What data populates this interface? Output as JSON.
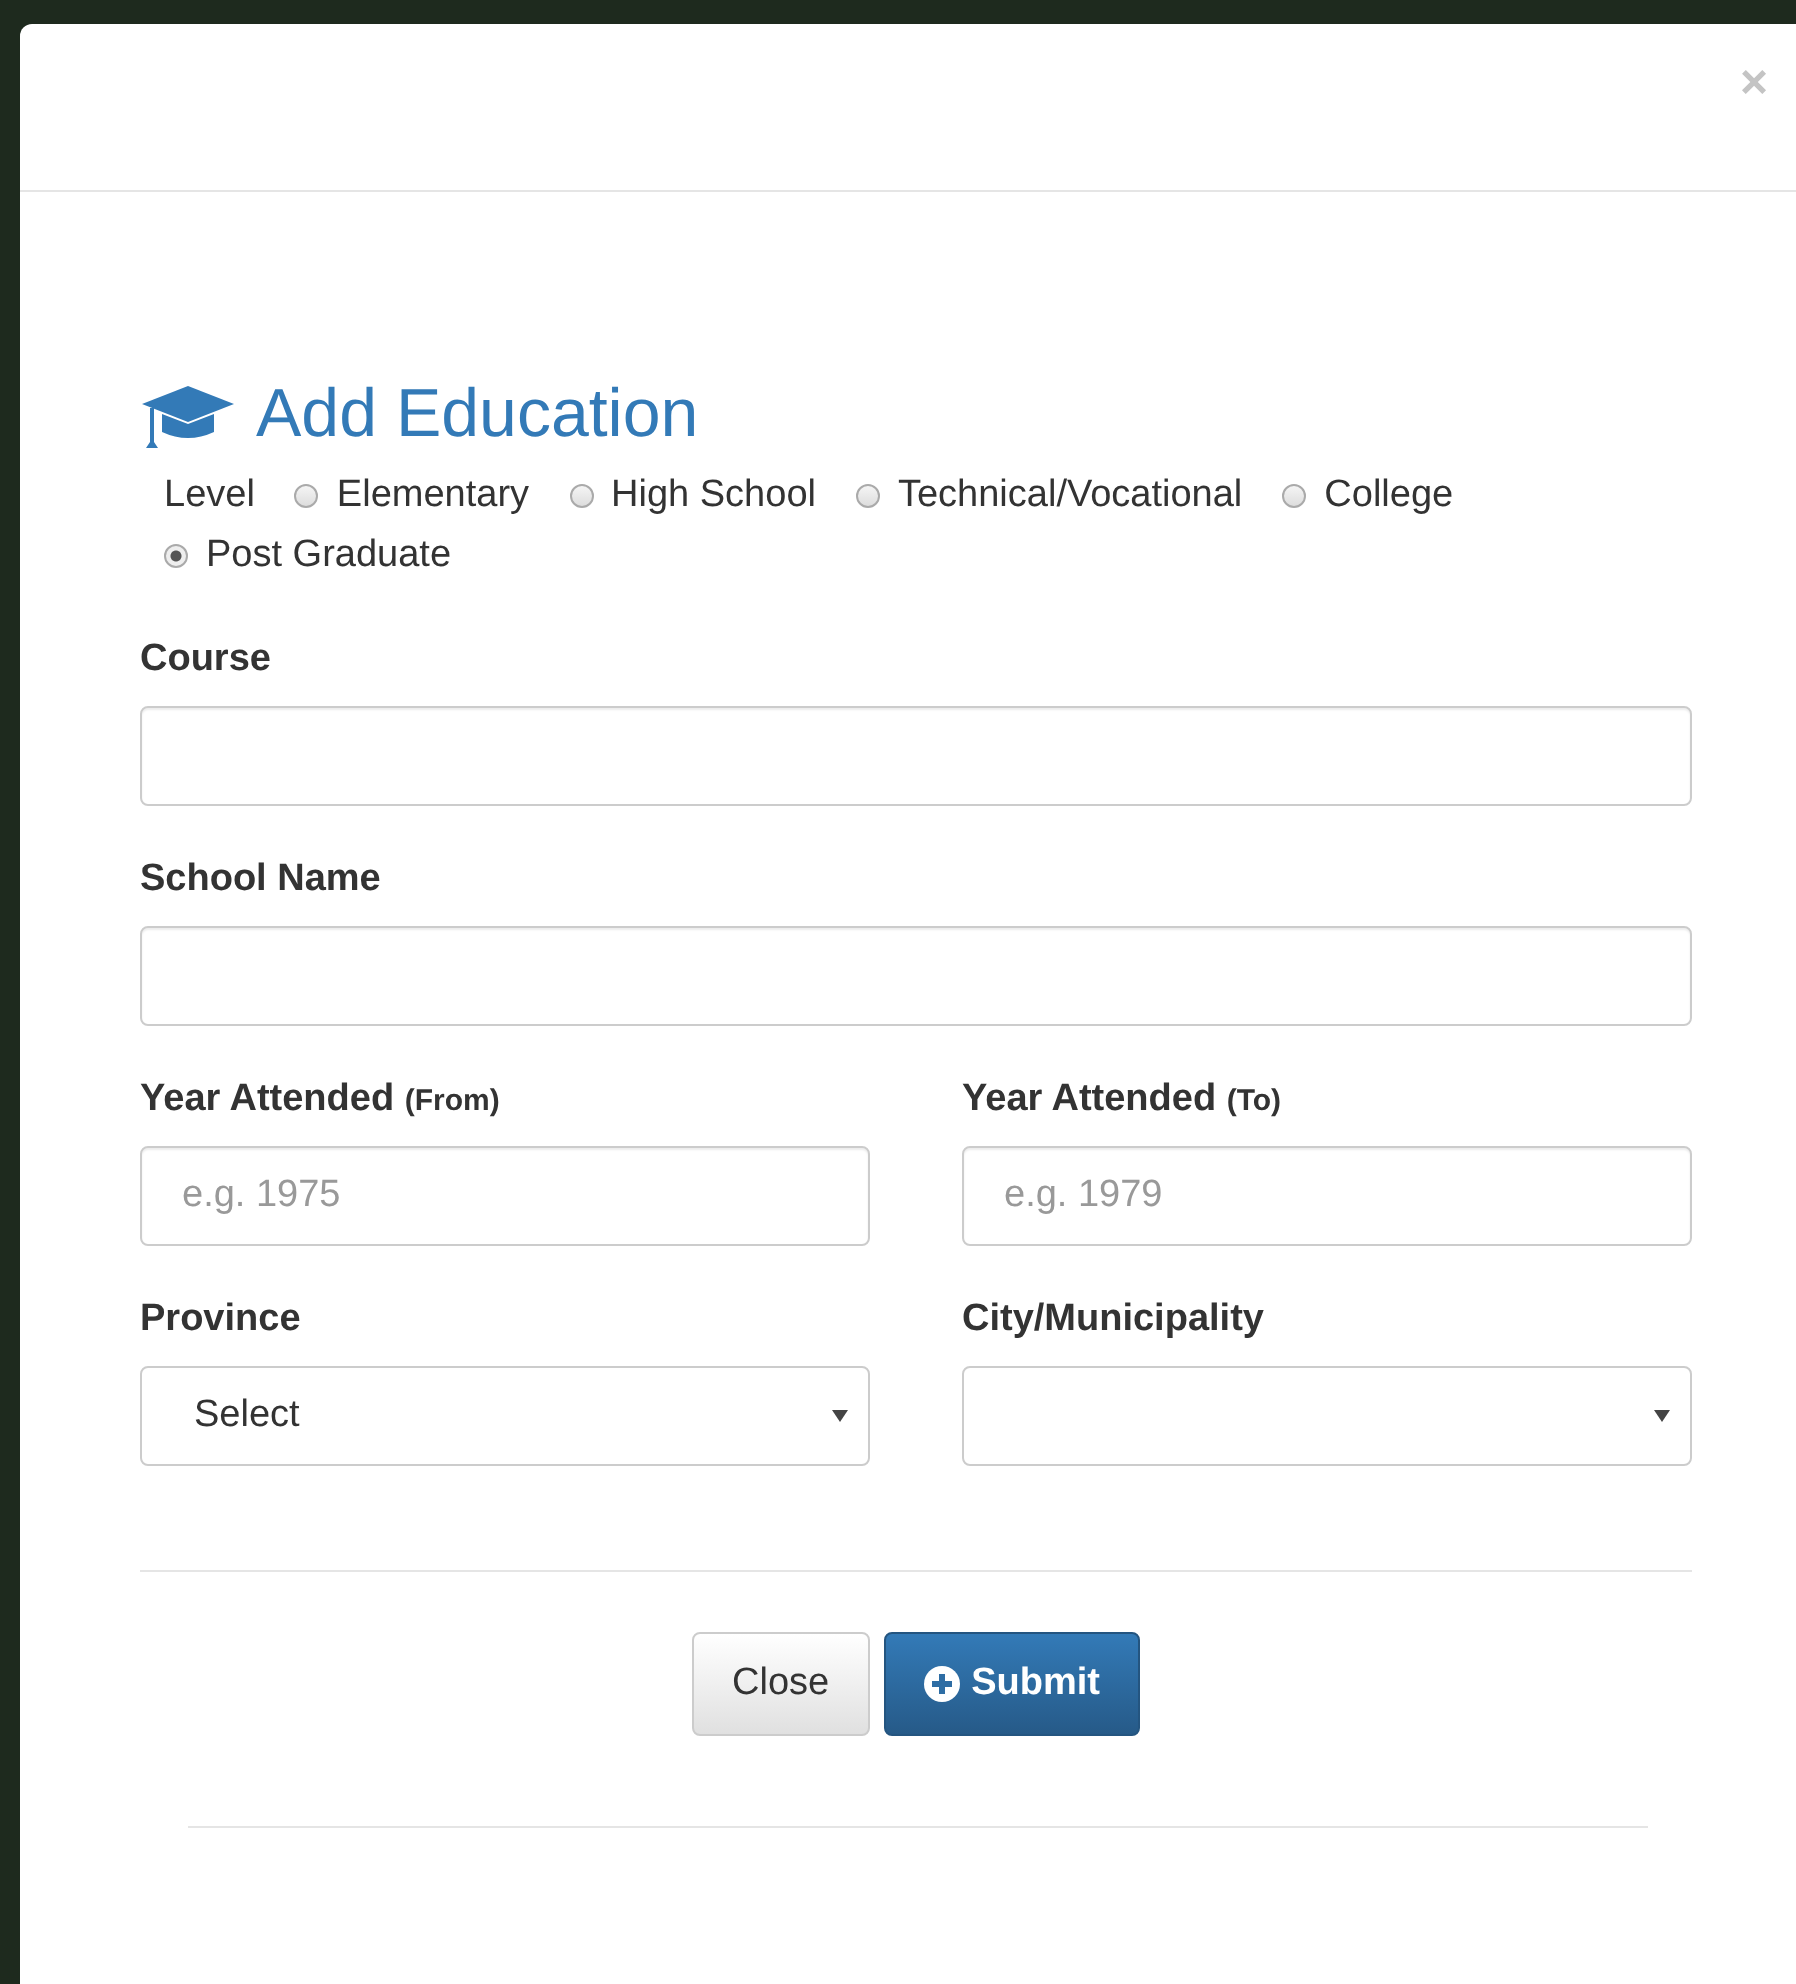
{
  "modal": {
    "close_symbol": "×",
    "title": "Add Education"
  },
  "level": {
    "label": "Level",
    "options": [
      {
        "label": "Elementary",
        "selected": false
      },
      {
        "label": "High School",
        "selected": false
      },
      {
        "label": "Technical/Vocational",
        "selected": false
      },
      {
        "label": "College",
        "selected": false
      },
      {
        "label": "Post Graduate",
        "selected": true
      }
    ]
  },
  "fields": [
    {
      "kind": "text",
      "label": "Course",
      "wide": true
    },
    {
      "kind": "text",
      "label": "School Name",
      "wide": true
    },
    {
      "kind": "text",
      "label": "Year Attended",
      "note": "(From)",
      "placeholder": "e.g. 1975",
      "wide": false
    },
    {
      "kind": "text",
      "label": "Year Attended",
      "note": "(To)",
      "placeholder": "e.g. 1979",
      "wide": false
    },
    {
      "kind": "select",
      "label": "Province",
      "value": "Select",
      "wide": false
    },
    {
      "kind": "select",
      "label": "City/Municipality",
      "wide": false
    }
  ],
  "buttons": [
    {
      "label": "Close",
      "kind": "default"
    },
    {
      "label": "Submit",
      "kind": "primary"
    }
  ]
}
